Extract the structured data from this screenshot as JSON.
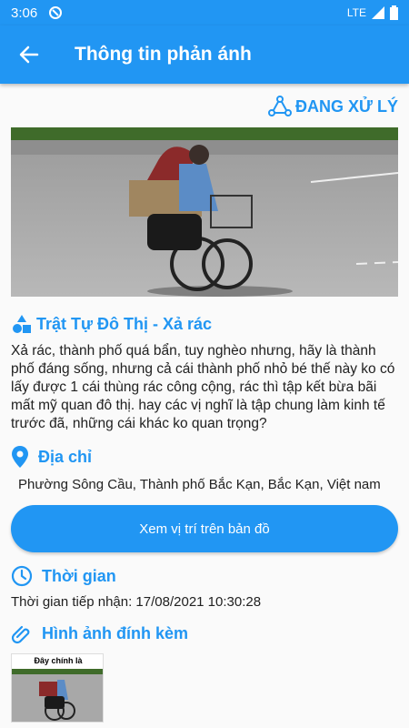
{
  "status_bar": {
    "time": "3:06",
    "network": "LTE"
  },
  "app_bar": {
    "title": "Thông tin phản ánh"
  },
  "report": {
    "status": "ĐANG XỬ LÝ",
    "category": "Trật Tự Đô Thị - Xả rác",
    "description": "Xả rác, thành phố quá bẩn, tuy nghèo nhưng, hãy là thành phố đáng sống, nhưng cả cái thành phố nhỏ bé thế này ko có lấy được 1 cái thùng rác công cộng, rác thì tập kết bừa bãi mất mỹ quan đô thị. hay các vị nghĩ là tập chung làm kinh tế trước đã, những cái khác ko quan trọng?"
  },
  "address": {
    "title": "Địa chỉ",
    "value": "Phường Sông Cầu, Thành phố Bắc Kạn, Bắc Kạn, Việt nam"
  },
  "map_button": {
    "label": "Xem vị trí trên bản đồ"
  },
  "time": {
    "title": "Thời gian",
    "value": "Thời gian tiếp nhận: 17/08/2021 10:30:28"
  },
  "attachments": {
    "title": "Hình ảnh đính kèm",
    "thumb_caption": "Đây chính là"
  },
  "colors": {
    "primary": "#2196f3"
  }
}
